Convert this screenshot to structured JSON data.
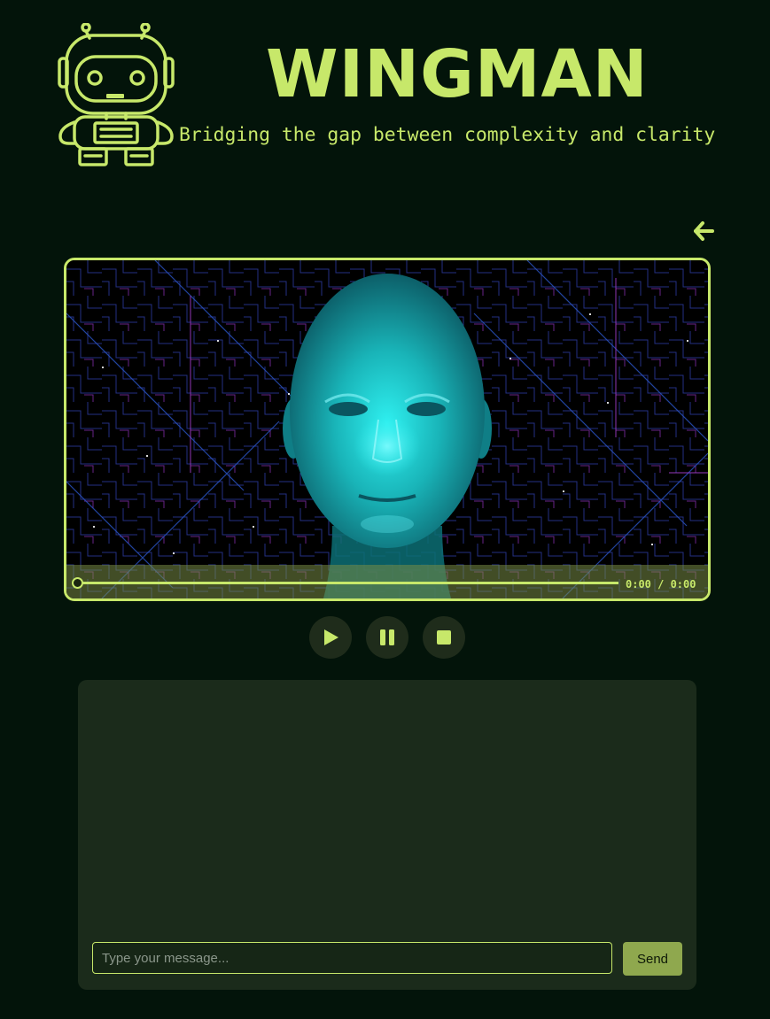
{
  "header": {
    "title": "WINGMAN",
    "subtitle": "Bridging the gap between complexity and clarity",
    "logo_icon": "robot-icon"
  },
  "nav": {
    "back_icon": "arrow-left-icon"
  },
  "video": {
    "time_display": "0:00 / 0:00",
    "progress": 0,
    "poster_subject": "digital-human-head-circuit-background"
  },
  "controls": {
    "play_icon": "play-icon",
    "pause_icon": "pause-icon",
    "stop_icon": "stop-icon"
  },
  "chat": {
    "input_value": "",
    "input_placeholder": "Type your message...",
    "send_label": "Send",
    "messages": []
  },
  "colors": {
    "background": "#03140a",
    "accent": "#c7e86a",
    "panel": "#1b2b1b",
    "button_bg": "#1f2c1b",
    "send_bg": "#8fa84e",
    "face_glow": "#22d4d4"
  }
}
